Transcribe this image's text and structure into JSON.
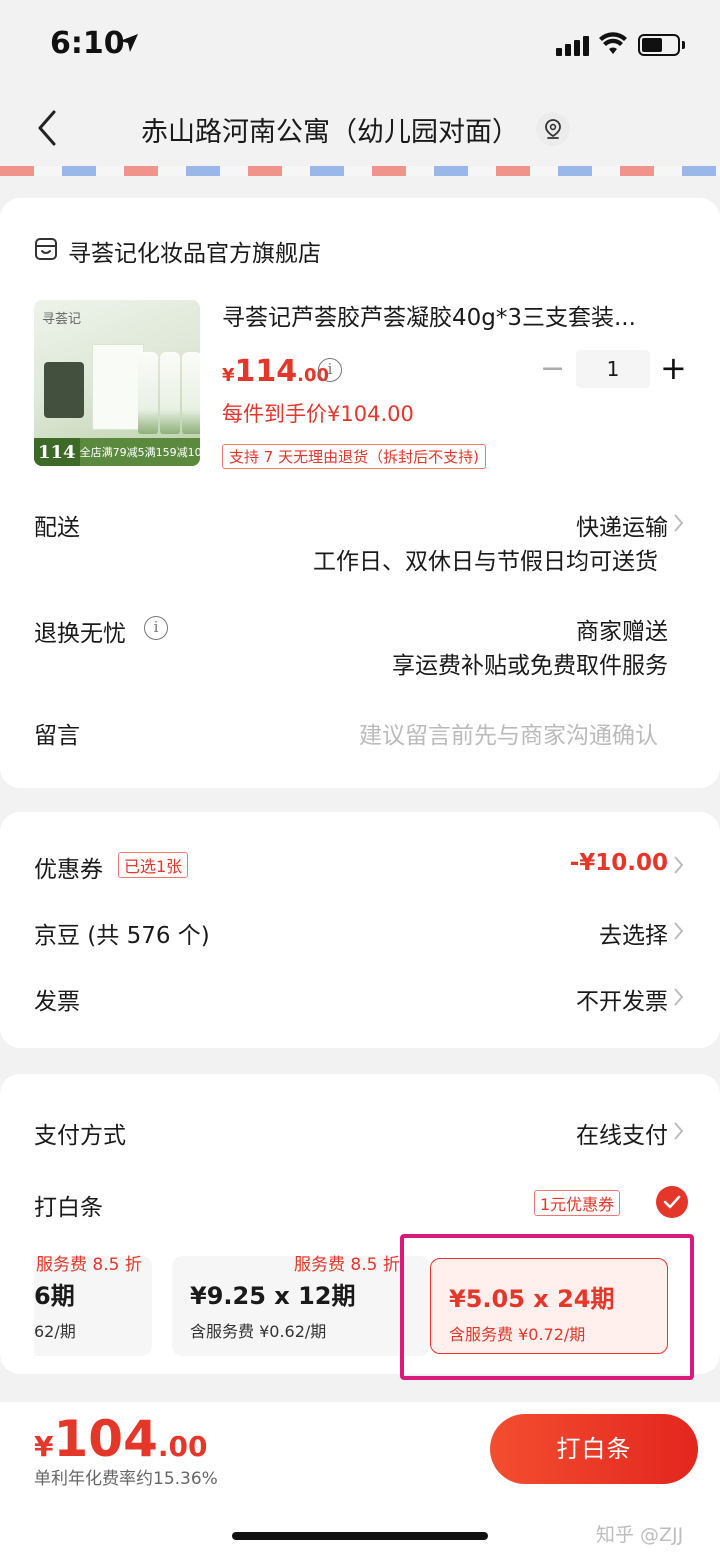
{
  "status_bar": {
    "time": "6:10"
  },
  "header": {
    "address": "赤山路河南公寓（幼儿园对面）"
  },
  "store": {
    "name": "寻荟记化妆品官方旗舰店"
  },
  "product": {
    "image_brand": "寻荟记",
    "image_promo_price": "114",
    "image_promo_text": "全店满79减5满159减10",
    "title": "寻荟记芦荟胶芦荟凝胶40g*3三支套装...",
    "price_currency": "¥",
    "price_int": "114",
    "price_dec": ".00",
    "quantity": "1",
    "unit_price": "每件到手价¥104.00",
    "return_tag": "支持 7 天无理由退货（拆封后不支持)"
  },
  "delivery": {
    "label": "配送",
    "method": "快递运输",
    "note": "工作日、双休日与节假日均可送货"
  },
  "return_service": {
    "label": "退换无忧",
    "value": "商家赠送",
    "note": "享运费补贴或免费取件服务"
  },
  "message": {
    "label": "留言",
    "placeholder": "建议留言前先与商家沟通确认"
  },
  "coupon": {
    "label": "优惠券",
    "tag": "已选1张",
    "value": "-¥10.00"
  },
  "jingdou": {
    "label": "京豆 (共 576 个)",
    "value": "去选择"
  },
  "invoice": {
    "label": "发票",
    "value": "不开发票"
  },
  "payment": {
    "label": "支付方式",
    "value": "在线支付"
  },
  "baitiao": {
    "label": "打白条",
    "coupon_tag": "1元优惠券",
    "options": [
      {
        "discount": "服务费 8.5 折",
        "main": "6期",
        "sub": "62/期"
      },
      {
        "discount": "服务费 8.5 折",
        "main": "¥9.25 x 12期",
        "sub": "含服务费 ¥0.62/期"
      },
      {
        "main": "¥5.05 x 24期",
        "sub": "含服务费 ¥0.72/期"
      }
    ]
  },
  "footer": {
    "total_currency": "¥",
    "total_int": "104",
    "total_dec": ".00",
    "apr_note": "单利年化费率约15.36%",
    "pay_button": "打白条",
    "watermark": "知乎 @ZJJ"
  }
}
